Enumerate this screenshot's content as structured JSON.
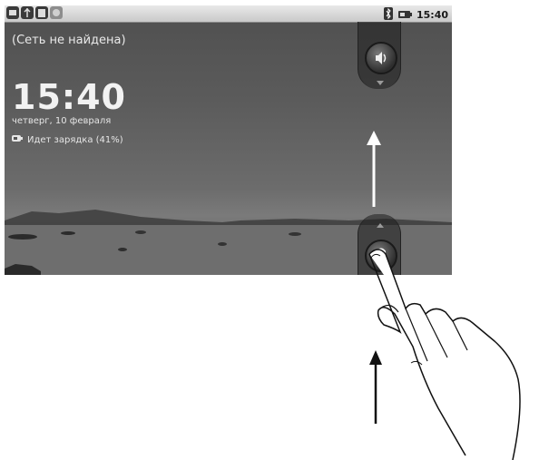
{
  "statusbar": {
    "left_icons": [
      "message-icon",
      "usb-debug-icon",
      "sd-card-icon",
      "android-icon"
    ],
    "right_icons": [
      "bluetooth-icon",
      "battery-icon"
    ],
    "time": "15:40"
  },
  "lockscreen": {
    "network_status": "(Сеть не найдена)",
    "clock": "15:40",
    "date": "четверг, 10 февраля",
    "charging": "Идет зарядка (41%)",
    "sound_toggle_icon": "speaker-icon",
    "unlock_icon": "lock-icon"
  },
  "colors": {
    "screen_bg": "#5a5a5a",
    "text": "#eaeaea",
    "statusbar": "#d4d4d4"
  }
}
